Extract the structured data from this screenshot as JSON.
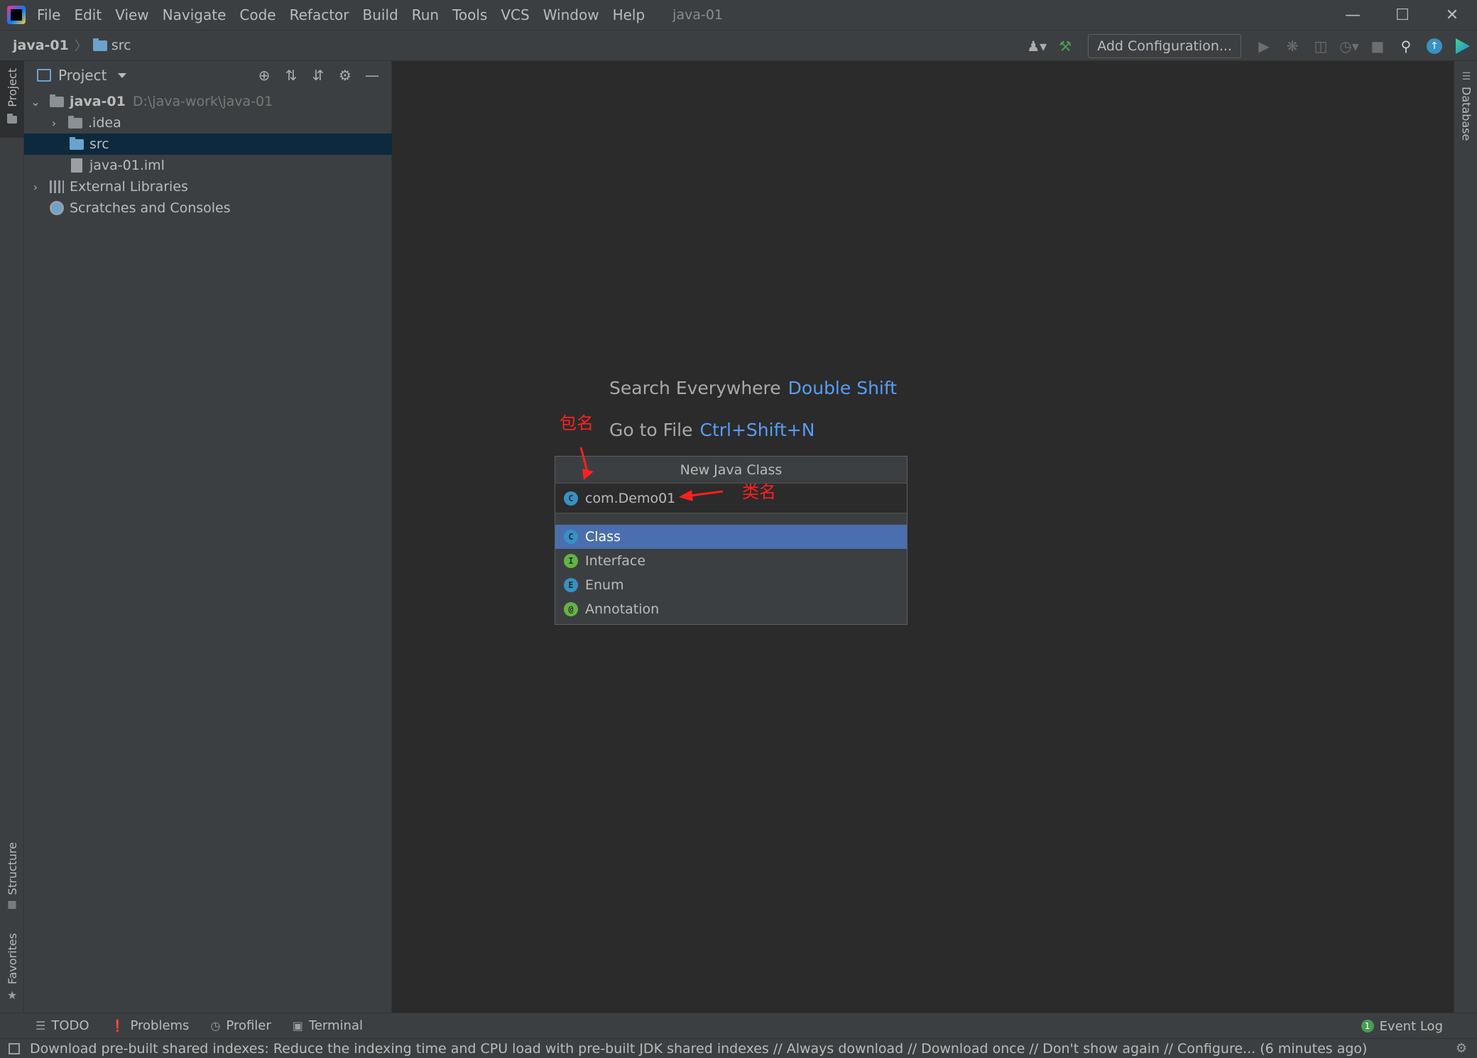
{
  "menu": {
    "items": [
      "File",
      "Edit",
      "View",
      "Navigate",
      "Code",
      "Refactor",
      "Build",
      "Run",
      "Tools",
      "VCS",
      "Window",
      "Help"
    ],
    "window_title": "java-01"
  },
  "navbar": {
    "project": "java-01",
    "folder": "src",
    "add_configuration": "Add Configuration..."
  },
  "left_strip": {
    "project": "Project",
    "structure": "Structure",
    "favorites": "Favorites"
  },
  "right_strip": {
    "database": "Database"
  },
  "project_panel": {
    "title": "Project",
    "tree": {
      "root": {
        "name": "java-01",
        "path": "D:\\java-work\\java-01"
      },
      "idea": ".idea",
      "src": "src",
      "iml": "java-01.iml",
      "external_libraries": "External Libraries",
      "scratches": "Scratches and Consoles"
    }
  },
  "editor": {
    "hints": [
      {
        "label": "Search Everywhere",
        "shortcut": "Double Shift"
      },
      {
        "label": "Go to File",
        "shortcut": "Ctrl+Shift+N"
      }
    ]
  },
  "new_class_popup": {
    "title": "New Java Class",
    "input_value": "com.Demo01",
    "kinds": [
      {
        "icon": "C",
        "label": "Class",
        "selected": true
      },
      {
        "icon": "I",
        "label": "Interface",
        "selected": false
      },
      {
        "icon": "E",
        "label": "Enum",
        "selected": false
      },
      {
        "icon": "@",
        "label": "Annotation",
        "selected": false
      }
    ]
  },
  "annotations": {
    "package_name": "包名",
    "class_name": "类名",
    "color": "#ff2020"
  },
  "bottom_bar": {
    "tabs": [
      "TODO",
      "Problems",
      "Profiler",
      "Terminal"
    ],
    "event_log": "Event Log",
    "event_count": "1"
  },
  "status_bar": {
    "message": "Download pre-built shared indexes: Reduce the indexing time and CPU load with pre-built JDK shared indexes // Always download // Download once // Don't show again // Configure... (6 minutes ago)"
  },
  "colors": {
    "accent_blue": "#589df6",
    "selection": "#4b6eaf",
    "tree_selection": "#0d293e"
  }
}
